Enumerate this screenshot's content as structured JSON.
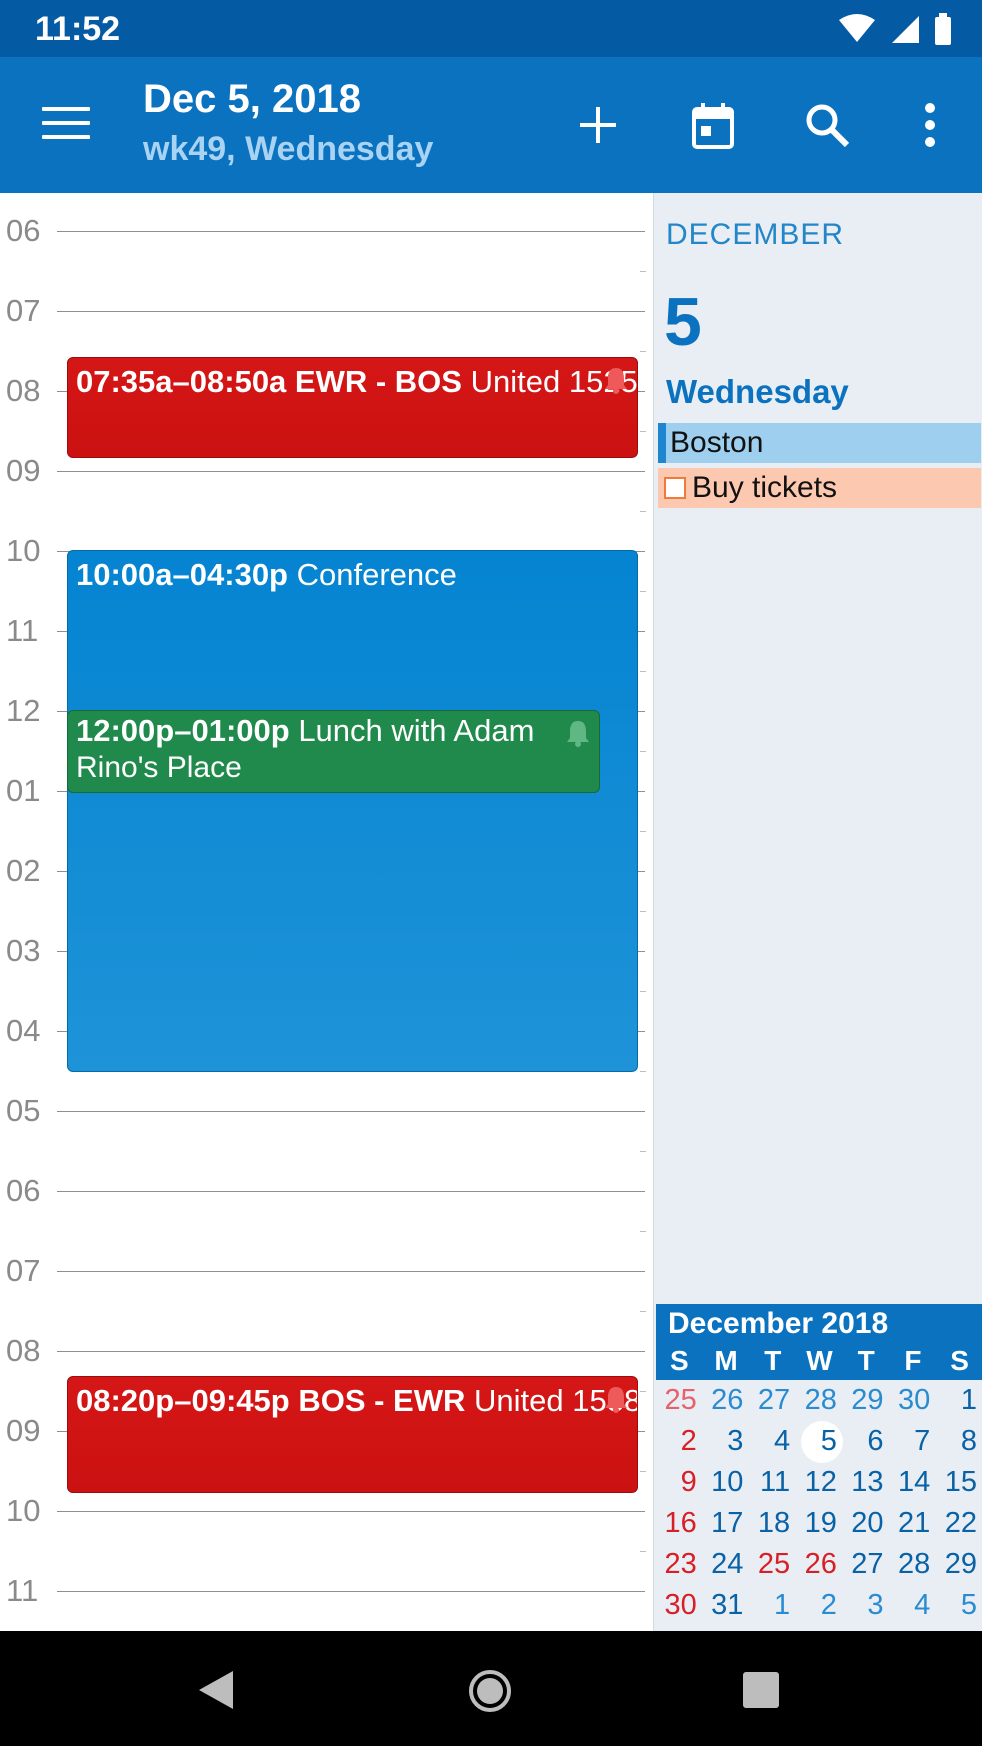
{
  "status": {
    "time": "11:52"
  },
  "appbar": {
    "title": "Dec 5, 2018",
    "subtitle": "wk49, Wednesday"
  },
  "grid": {
    "hours": [
      "06",
      "07",
      "08",
      "09",
      "10",
      "11",
      "12",
      "01",
      "02",
      "03",
      "04",
      "05",
      "06",
      "07",
      "08",
      "09",
      "10",
      "11"
    ]
  },
  "events": [
    {
      "time": "07:35a–08:50a",
      "title": "EWR - BOS",
      "detail": "United 1525",
      "color": "#d41414"
    },
    {
      "time": "10:00a–04:30p",
      "title": "Conference",
      "color": "#0a84d2"
    },
    {
      "time": "12:00p–01:00p",
      "title": "Lunch with Adam",
      "location": "Rino's Place",
      "color": "#1f8a4c"
    },
    {
      "time": "08:20p–09:45p",
      "title": "BOS - EWR",
      "detail": "United 1538",
      "color": "#d41414"
    }
  ],
  "panel": {
    "month": "DECEMBER",
    "day_number": "5",
    "day_name": "Wednesday",
    "allday_event": "Boston",
    "task": "Buy tickets"
  },
  "mini_calendar": {
    "header": "December 2018",
    "weekdays": [
      "S",
      "M",
      "T",
      "W",
      "T",
      "F",
      "S"
    ],
    "weeks": [
      [
        "25",
        "26",
        "27",
        "28",
        "29",
        "30",
        "1"
      ],
      [
        "2",
        "3",
        "4",
        "5",
        "6",
        "7",
        "8"
      ],
      [
        "9",
        "10",
        "11",
        "12",
        "13",
        "14",
        "15"
      ],
      [
        "16",
        "17",
        "18",
        "19",
        "20",
        "21",
        "22"
      ],
      [
        "23",
        "24",
        "25",
        "26",
        "27",
        "28",
        "29"
      ],
      [
        "30",
        "31",
        "1",
        "2",
        "3",
        "4",
        "5"
      ]
    ],
    "selected_day": "5",
    "holidays": [
      "25",
      "26"
    ]
  }
}
